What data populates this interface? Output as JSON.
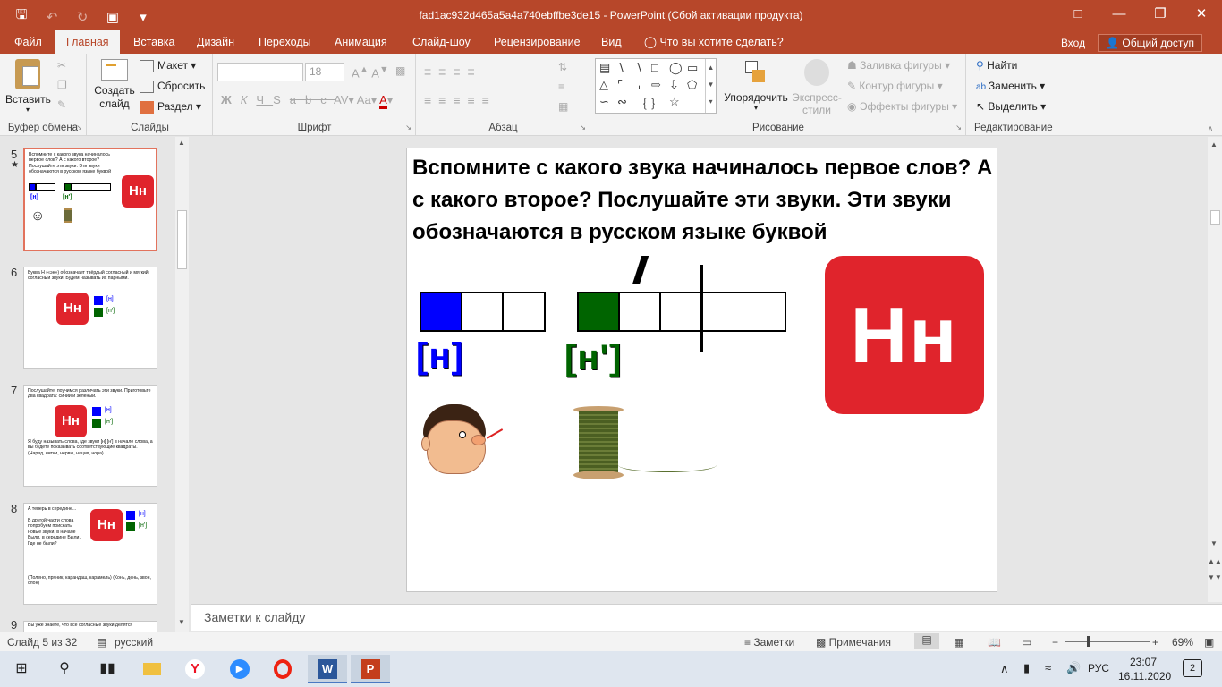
{
  "window": {
    "title": "fad1ac932d465a5a4a740ebffbe3de15  -  PowerPoint (Сбой активации продукта)"
  },
  "tabs": [
    "Файл",
    "Главная",
    "Вставка",
    "Дизайн",
    "Переходы",
    "Анимация",
    "Слайд-шоу",
    "Рецензирование",
    "Вид"
  ],
  "tell_me": "Что вы хотите сделать?",
  "login": "Вход",
  "share": "Общий доступ",
  "ribbon": {
    "paste": "Вставить",
    "new_slide": "Создать\nслайд",
    "layout": "Макет",
    "reset": "Сбросить",
    "section": "Раздел",
    "font_size": "18",
    "arrange": "Упорядочить",
    "quick_styles": "Экспресс-\nстили",
    "fill": "Заливка фигуры",
    "outline": "Контур фигуры",
    "effects": "Эффекты фигуры",
    "find": "Найти",
    "replace": "Заменить",
    "select": "Выделить",
    "groups": {
      "clipboard": "Буфер обмена",
      "slides": "Слайды",
      "font": "Шрифт",
      "paragraph": "Абзац",
      "drawing": "Рисование",
      "editing": "Редактирование"
    }
  },
  "thumbnails": [
    {
      "num": "5",
      "text": "Вспомните с какого звука начиналось первое слов? А с какого второе? Послушайте эти звуки. Эти звуки обозначаются в русском языке буквой"
    },
    {
      "num": "6",
      "text": "Буква Н («эн») обозначает твёрдый согласный и мягкий согласный звуки. Будем называть их парными.",
      "s1": "[н]",
      "s2": "[н']"
    },
    {
      "num": "7",
      "text": "Послушайте, поучимся различать эти звуки. Приготовьте два квадрата: синий и зелёный.",
      "s1": "[н]",
      "s2": "[н']",
      "text2": "Я буду называть слова, где звуки [н] [н'] в начале слова, а вы будете показывать соответствующие квадраты. (Наряд, нитки, нервы, нация, нора)"
    },
    {
      "num": "8",
      "text": "А теперь в середине...",
      "text2": "В другой части слова попробуем поискать новые звуки, в начале Были, в середине Были. Где не были?",
      "text3": "(Полено, пряник, карандаш, карамель) (Конь, день, звон, слон)",
      "s1": "[н]",
      "s2": "[н']"
    },
    {
      "num": "9",
      "text": "Вы уже знаете, что все согласные звуки делятся"
    }
  ],
  "slide": {
    "title": "Вспомните с какого звука начиналось первое слов? А с какого второе? Послушайте эти звуки. Эти звуки обозначаются в русском языке буквой",
    "sound_hard": "[н]",
    "sound_soft": "[н']",
    "letter": "Нн",
    "colors": {
      "hard": "#0000ff",
      "soft": "#006400",
      "logo": "#e0242c"
    }
  },
  "notes_placeholder": "Заметки к слайду",
  "status": {
    "slide_info": "Слайд 5 из 32",
    "language": "русский",
    "notes_btn": "Заметки",
    "comments_btn": "Примечания",
    "zoom": "69%"
  },
  "taskbar": {
    "lang": "РУС",
    "time": "23:07",
    "date": "16.11.2020",
    "notif_count": "2"
  }
}
